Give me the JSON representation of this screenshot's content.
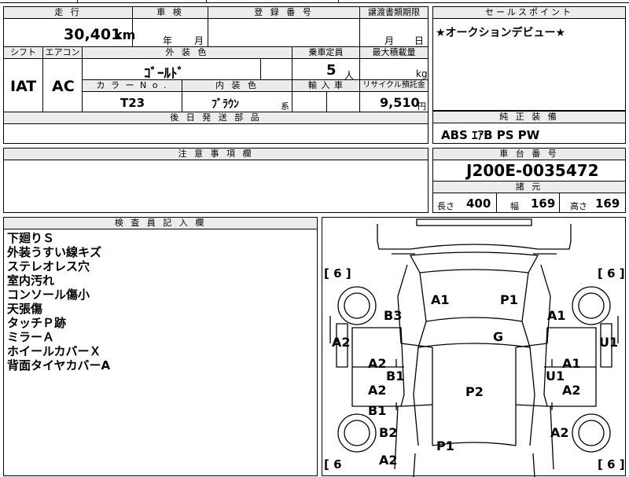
{
  "top_strip": {
    "partial_text": "..."
  },
  "main": {
    "mileage_header": "走 行",
    "mileage_value": "30,401",
    "mileage_unit": "km",
    "inspection_header": "車 検",
    "inspection_year": "年",
    "inspection_month": "月",
    "registration_header": "登 録 番 号",
    "transfer_header": "譲渡書類期限",
    "transfer_month": "月",
    "transfer_day": "日",
    "shift_header": "シフト",
    "shift_value": "IAT",
    "ac_header": "エアコン",
    "ac_value": "AC",
    "exterior_color_header": "外 装 色",
    "exterior_color_value": "ｺﾞｰﾙﾄﾞ",
    "capacity_header": "乗車定員",
    "capacity_value": "5",
    "capacity_unit": "人",
    "max_load_header": "最大積載量",
    "max_load_unit": "kg",
    "color_no_header": "カ ラ ー N o .",
    "color_no_value": "T23",
    "interior_color_header": "内 装 色",
    "interior_color_value": "ﾌﾞﾗｳﾝ",
    "interior_color_suffix": "系",
    "import_header": "輸 入 車",
    "recycle_header": "リサイクル預託金",
    "recycle_value": "9,510",
    "recycle_unit": "円",
    "later_parts_header": "後 日 発 送 部 品"
  },
  "sales_point": {
    "header": "セールスポイント",
    "text": "★オークションデビュー★"
  },
  "equipment": {
    "header": "純 正 装 備",
    "text": "ABS ｴｱB PS PW"
  },
  "notes": {
    "header": "注 意 事 項 欄"
  },
  "chassis": {
    "header": "車 台 番 号",
    "value": "J200E-0035472"
  },
  "specs": {
    "header": "諸 元",
    "length_label": "長さ",
    "length_value": "400",
    "width_label": "幅",
    "width_value": "169",
    "height_label": "高さ",
    "height_value": "169"
  },
  "inspector": {
    "header": "検 査 員 記 入 欄",
    "lines": [
      "下廻りＳ",
      "外装うすい線キズ",
      "ステレオレス穴",
      "室内汚れ",
      "コンソール傷小",
      "天張傷",
      "タッチＰ跡",
      "ミラーＡ",
      "ホイールカバーＸ",
      "背面タイヤカバーA"
    ]
  },
  "diagram": {
    "tire_marks": {
      "front_left": "[ 6 ]",
      "front_right": "[ 6 ]",
      "rear_left": "[ 6",
      "rear_right": "[ 6 ]"
    },
    "labels": {
      "hood_left": "A1",
      "hood_right": "P1",
      "front_left_fender": "B3",
      "front_right_fender": "A1",
      "left_mirror": "A2",
      "right_mirror": "U1",
      "windshield": "G",
      "left_front_door": "A2",
      "left_front_door_b": "B1",
      "right_front_door": "A1",
      "right_front_door_b": "U1",
      "left_rear_door": "A2",
      "left_rear_door_b": "B1",
      "right_rear_door": "A2",
      "roof": "P2",
      "rear_left_fender": "B2",
      "rear_right_fender": "A2",
      "rear_left_corner": "A2",
      "tailgate": "P1"
    }
  }
}
